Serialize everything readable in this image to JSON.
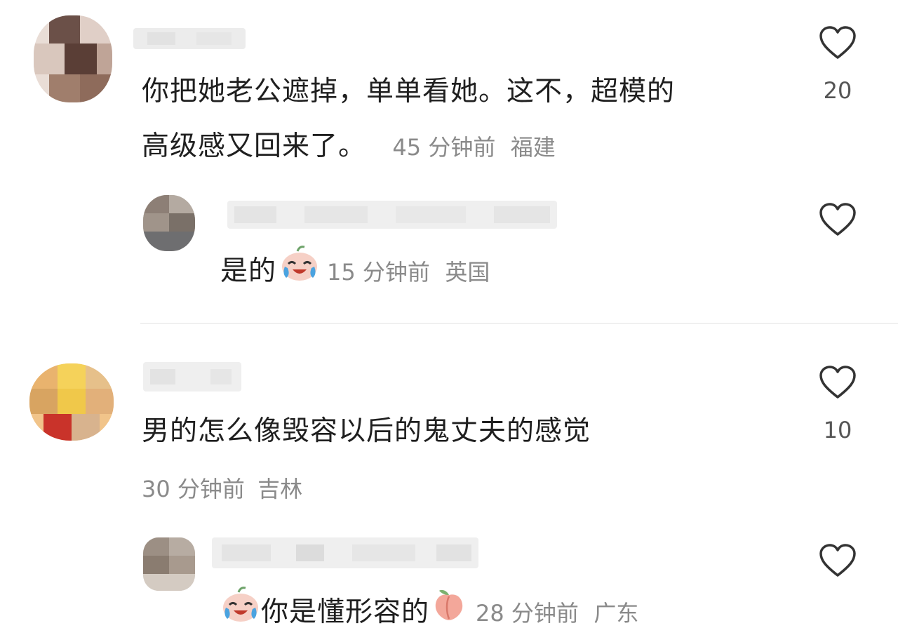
{
  "comments": [
    {
      "text_line1": "你把她老公遮掉，单单看她。这不，超模的",
      "text_line2": "高级感又回来了。",
      "time": "45 分钟前",
      "location": "福建",
      "likes": "20",
      "reply": {
        "text": "是的",
        "time": "15 分钟前",
        "location": "英国"
      }
    },
    {
      "text_line1": "男的怎么像毁容以后的鬼丈夫的感觉",
      "time": "30 分钟前",
      "location": "吉林",
      "likes": "10",
      "reply": {
        "text": "你是懂形容的",
        "time": "28 分钟前",
        "location": "广东"
      }
    }
  ],
  "icons": {
    "like": "heart-outline-icon",
    "reply1_emoji": "crying-laughing-emoji",
    "reply2_emoji_lead": "crying-laughing-emoji",
    "reply2_emoji_trail": "peach-emoji"
  },
  "colors": {
    "text": "#1f1f1f",
    "meta": "#8a8a8a",
    "icon": "#333333"
  }
}
